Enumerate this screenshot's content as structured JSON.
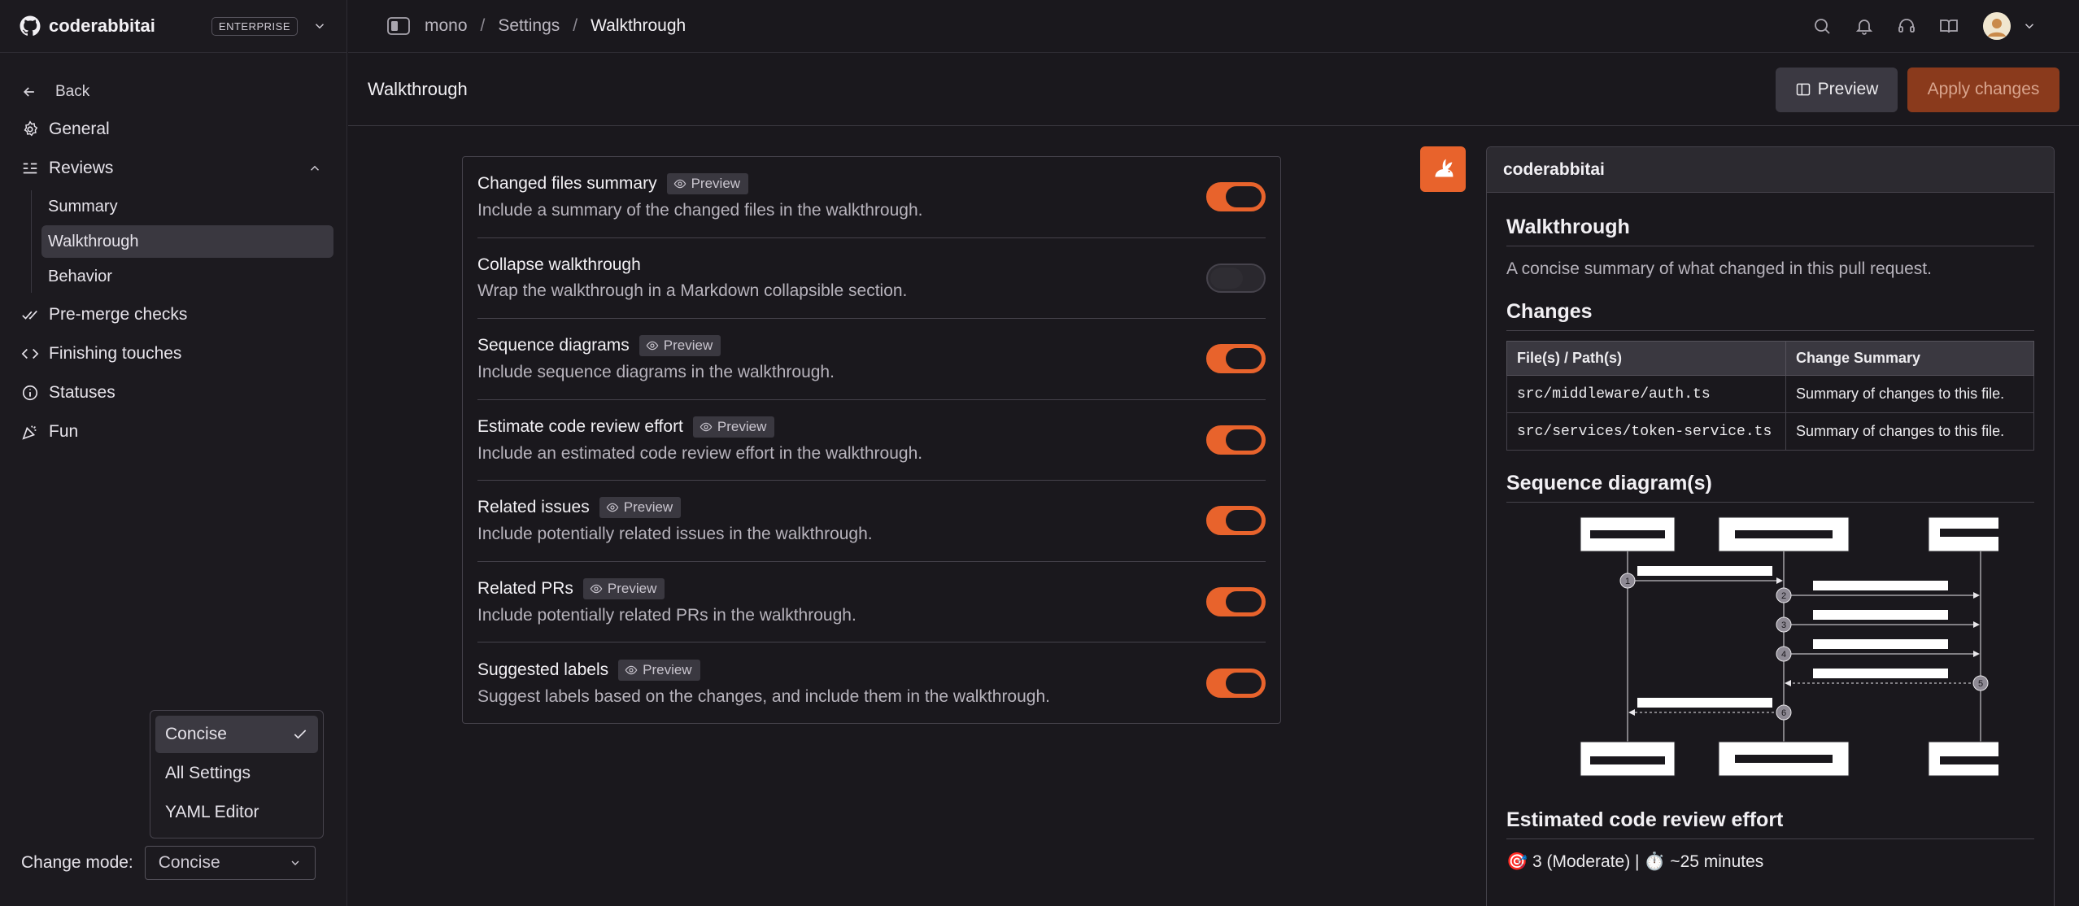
{
  "sidebar": {
    "org_name": "coderabbitai",
    "plan_badge": "ENTERPRISE",
    "back_label": "Back",
    "items": [
      {
        "label": "General",
        "icon": "gear-icon"
      },
      {
        "label": "Reviews",
        "icon": "list-icon"
      },
      {
        "label": "Pre-merge checks",
        "icon": "double-check-icon"
      },
      {
        "label": "Finishing touches",
        "icon": "code-icon"
      },
      {
        "label": "Statuses",
        "icon": "info-icon"
      },
      {
        "label": "Fun",
        "icon": "party-icon"
      }
    ],
    "review_subitems": [
      {
        "label": "Summary"
      },
      {
        "label": "Walkthrough"
      },
      {
        "label": "Behavior"
      }
    ],
    "mode_menu": [
      "Concise",
      "All Settings",
      "YAML Editor"
    ],
    "change_mode_label": "Change mode:",
    "mode_value": "Concise"
  },
  "topbar": {
    "crumbs": [
      "mono",
      "Settings",
      "Walkthrough"
    ],
    "separator": "/"
  },
  "subheader": {
    "title": "Walkthrough",
    "preview_button": "Preview",
    "apply_button": "Apply changes"
  },
  "settings": [
    {
      "title": "Changed files summary",
      "badge": "Preview",
      "desc": "Include a summary of the changed files in the walkthrough.",
      "enabled": true
    },
    {
      "title": "Collapse walkthrough",
      "badge": "",
      "desc": "Wrap the walkthrough in a Markdown collapsible section.",
      "enabled": false
    },
    {
      "title": "Sequence diagrams",
      "badge": "Preview",
      "desc": "Include sequence diagrams in the walkthrough.",
      "enabled": true
    },
    {
      "title": "Estimate code review effort",
      "badge": "Preview",
      "desc": "Include an estimated code review effort in the walkthrough.",
      "enabled": true
    },
    {
      "title": "Related issues",
      "badge": "Preview",
      "desc": "Include potentially related issues in the walkthrough.",
      "enabled": true
    },
    {
      "title": "Related PRs",
      "badge": "Preview",
      "desc": "Include potentially related PRs in the walkthrough.",
      "enabled": true
    },
    {
      "title": "Suggested labels",
      "badge": "Preview",
      "desc": "Suggest labels based on the changes, and include them in the walkthrough.",
      "enabled": true
    }
  ],
  "preview": {
    "author": "coderabbitai",
    "walkthrough_heading": "Walkthrough",
    "walkthrough_text": "A concise summary of what changed in this pull request.",
    "changes_heading": "Changes",
    "table_headers": [
      "File(s) / Path(s)",
      "Change Summary"
    ],
    "table_rows": [
      [
        "src/middleware/auth.ts",
        "Summary of changes to this file."
      ],
      [
        "src/services/token-service.ts",
        "Summary of changes to this file."
      ]
    ],
    "sequence_heading": "Sequence diagram(s)",
    "sequence_steps": [
      "1",
      "2",
      "3",
      "4",
      "5",
      "6"
    ],
    "effort_heading": "Estimated code review effort",
    "effort_text": "🎯 3 (Moderate) | ⏱️ ~25 minutes"
  },
  "colors": {
    "accent": "#e8632c",
    "background": "#1a181d",
    "apply_button_bg": "#8a3a1c"
  }
}
